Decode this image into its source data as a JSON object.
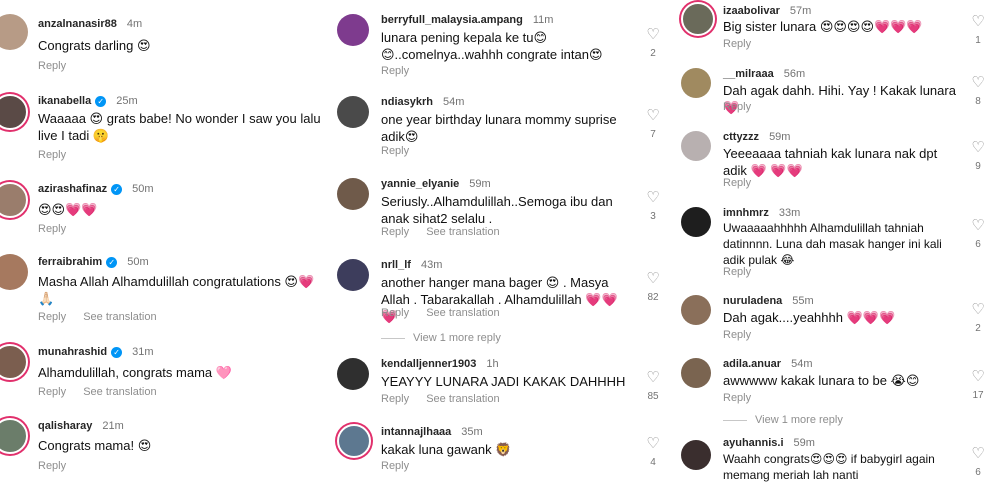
{
  "columns": [
    {
      "id": "col1",
      "comments": [
        {
          "user": "anzalnanasir88",
          "verified": false,
          "time": "4m",
          "text": "Congrats darling 😍",
          "reply": "Reply",
          "see_translation": "",
          "likes": "",
          "avatar_color": "#b79b86",
          "ring": false
        },
        {
          "user": "ikanabella",
          "verified": true,
          "time": "25m",
          "text": "Waaaaa 😍 grats babe! No wonder I saw you lalu live I tadi 🤫",
          "reply": "Reply",
          "see_translation": "",
          "likes": "",
          "avatar_color": "#5a4a46",
          "ring": true
        },
        {
          "user": "azirashafinaz",
          "verified": true,
          "time": "50m",
          "text": "😍😍💗💗",
          "reply": "Reply",
          "see_translation": "",
          "likes": "",
          "avatar_color": "#9a7d6c",
          "ring": true
        },
        {
          "user": "ferraibrahim",
          "verified": true,
          "time": "50m",
          "text": "Masha Allah Alhamdulillah congratulations 😍💗🙏🏻",
          "reply": "Reply",
          "see_translation": "See translation",
          "likes": "",
          "avatar_color": "#a6795f",
          "ring": false
        },
        {
          "user": "munahrashid",
          "verified": true,
          "time": "31m",
          "text": "Alhamdulillah, congrats mama 🩷",
          "reply": "Reply",
          "see_translation": "See translation",
          "likes": "",
          "avatar_color": "#7b5e4f",
          "ring": true
        },
        {
          "user": "qalisharay",
          "verified": false,
          "time": "21m",
          "text": "Congrats mama! 😍",
          "reply": "Reply",
          "see_translation": "",
          "likes": "",
          "avatar_color": "#6b7d6a",
          "ring": true
        }
      ]
    },
    {
      "id": "col2",
      "comments": [
        {
          "user": "berryfull_malaysia.ampang",
          "verified": false,
          "time": "11m",
          "text": "lunara pening kepala ke tu😊 😊..comelnya..wahhh congrate intan😍",
          "reply": "Reply",
          "see_translation": "",
          "likes": "2",
          "avatar_color": "#7e3b8e",
          "ring": false
        },
        {
          "user": "ndiasykrh",
          "verified": false,
          "time": "54m",
          "text": "one year birthday lunara mommy suprise adik😍",
          "reply": "Reply",
          "see_translation": "",
          "likes": "7",
          "avatar_color": "#4a4a4a",
          "ring": false
        },
        {
          "user": "yannie_elyanie",
          "verified": false,
          "time": "59m",
          "text": "Seriusly..Alhamdulillah..Semoga ibu dan anak sihat2 selalu .",
          "reply": "Reply",
          "see_translation": "See translation",
          "likes": "3",
          "avatar_color": "#6f5a4a",
          "ring": false
        },
        {
          "user": "nrll_lf",
          "verified": false,
          "time": "43m",
          "text": "another hanger mana bager 😍 . Masya Allah . Tabarakallah . Alhamdulillah 💗💗💗",
          "reply": "Reply",
          "see_translation": "See translation",
          "likes": "82",
          "avatar_color": "#3d3d5c",
          "ring": false
        },
        {
          "user": "kendalljenner1903",
          "verified": false,
          "time": "1h",
          "text": "YEAYYY LUNARA JADI KAKAK DAHHHH",
          "reply": "Reply",
          "see_translation": "See translation",
          "likes": "85",
          "avatar_color": "#2f2f2f",
          "ring": false
        },
        {
          "user": "intannajlhaaa",
          "verified": false,
          "time": "35m",
          "text": "kakak luna gawank 🦁",
          "reply": "Reply",
          "see_translation": "",
          "likes": "4",
          "avatar_color": "#5d7890",
          "ring": true
        }
      ],
      "view_more": "View 1 more reply"
    },
    {
      "id": "col3",
      "comments": [
        {
          "user": "izaabolivar",
          "verified": false,
          "time": "57m",
          "text": "Big sister lunara 😍😍😍😍💗💗💗",
          "reply": "Reply",
          "see_translation": "",
          "likes": "1",
          "avatar_color": "#6a6a5a",
          "ring": true
        },
        {
          "user": "__milraaa",
          "verified": false,
          "time": "56m",
          "text": "Dah agak dahh. Hihi. Yay ! Kakak lunara💗",
          "reply": "Reply",
          "see_translation": "",
          "likes": "8",
          "avatar_color": "#a08a60",
          "ring": false
        },
        {
          "user": "cttyzzz",
          "verified": false,
          "time": "59m",
          "text": "Yeeeaaaa tahniah kak lunara nak dpt adik 💗 💗💗",
          "reply": "Reply",
          "see_translation": "",
          "likes": "9",
          "avatar_color": "#b8b0b0",
          "ring": false
        },
        {
          "user": "imnhmrz",
          "verified": false,
          "time": "33m",
          "text": "Uwaaaaahhhhh Alhamdulillah tahniah datinnnn. Luna dah masak hanger ini kali adik pulak 😂",
          "reply": "Reply",
          "see_translation": "",
          "likes": "6",
          "avatar_color": "#1e1e1e",
          "ring": false
        },
        {
          "user": "nuruladena",
          "verified": false,
          "time": "55m",
          "text": "Dah agak....yeahhhh 💗💗💗",
          "reply": "Reply",
          "see_translation": "",
          "likes": "2",
          "avatar_color": "#8a6f5a",
          "ring": false
        },
        {
          "user": "adila.anuar",
          "verified": false,
          "time": "54m",
          "text": "awwwww kakak lunara to be 😭😊",
          "reply": "Reply",
          "see_translation": "",
          "likes": "17",
          "avatar_color": "#7a6450",
          "ring": false
        },
        {
          "user": "ayuhannis.i",
          "verified": false,
          "time": "59m",
          "text": "Waahh congrats😍😍😍 if babygirl again memang meriah lah nanti",
          "reply": "Reply",
          "see_translation": "",
          "likes": "6",
          "avatar_color": "#3a2e2e",
          "ring": false
        }
      ],
      "view_more": "View 1 more reply"
    }
  ],
  "icons": {
    "like": "heart-outline-icon",
    "verified": "verified-badge-icon"
  }
}
